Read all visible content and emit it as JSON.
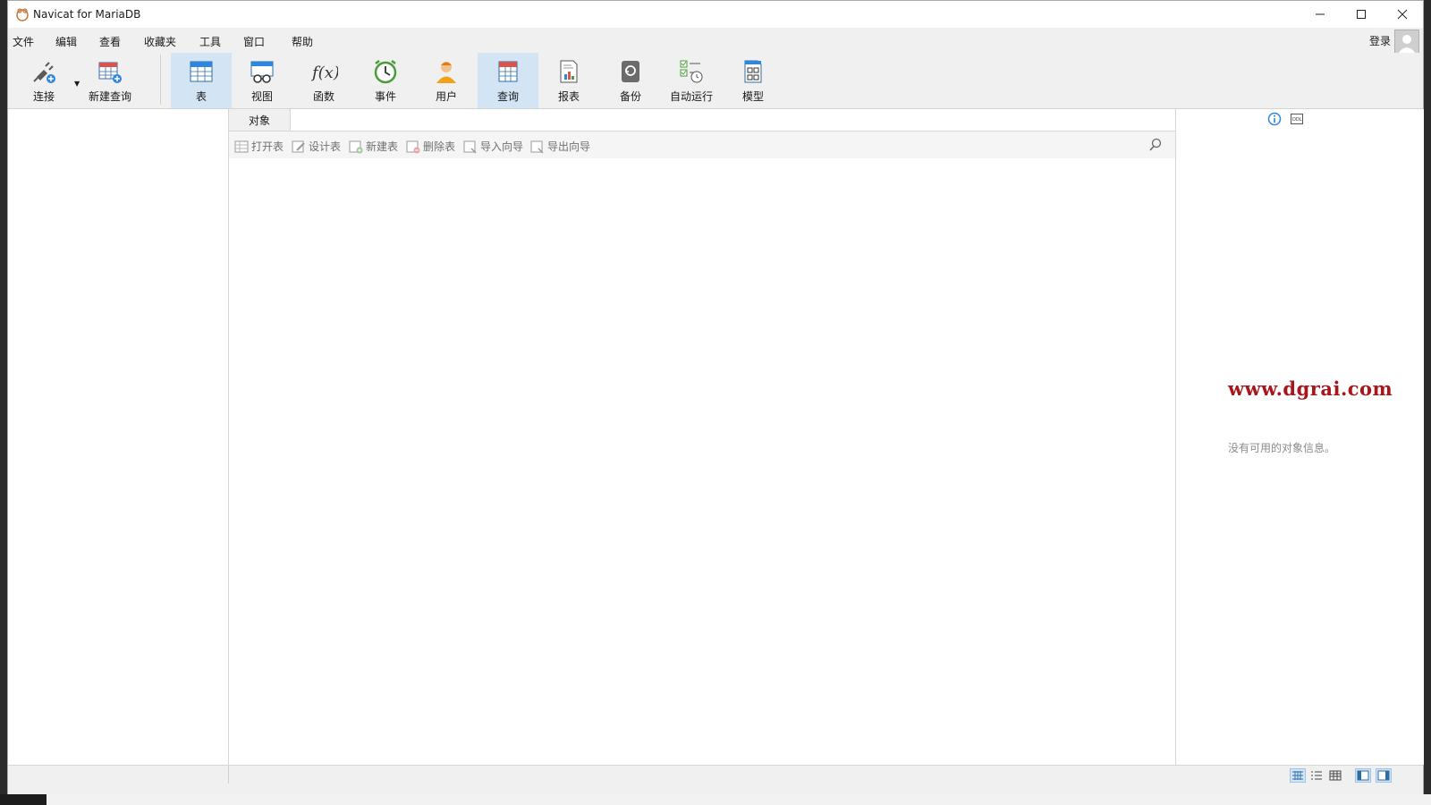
{
  "window": {
    "title": "Navicat for MariaDB"
  },
  "menu": [
    "文件",
    "编辑",
    "查看",
    "收藏夹",
    "工具",
    "窗口",
    "帮助"
  ],
  "account": {
    "login_label": "登录"
  },
  "toolbar": {
    "connect": "连接",
    "new_query": "新建查询",
    "table": "表",
    "view": "视图",
    "function": "函数",
    "event": "事件",
    "user": "用户",
    "query": "查询",
    "report": "报表",
    "backup": "备份",
    "automation": "自动运行",
    "model": "模型"
  },
  "tabs": {
    "objects": "对象"
  },
  "object_toolbar": {
    "open_table": "打开表",
    "design_table": "设计表",
    "new_table": "新建表",
    "delete_table": "删除表",
    "import_wizard": "导入向导",
    "export_wizard": "导出向导"
  },
  "info_panel": {
    "watermark": "www.dgrai.com",
    "empty_message": "没有可用的对象信息。"
  },
  "colors": {
    "accent": "#d3e4f4",
    "watermark": "#a8151b"
  }
}
